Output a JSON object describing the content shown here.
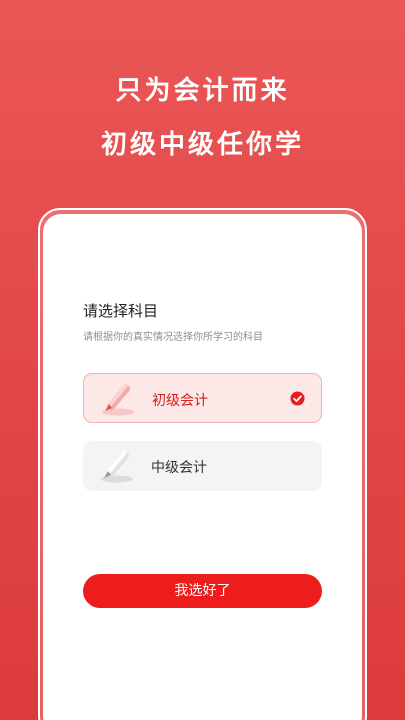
{
  "hero": {
    "line1": "只为会计而来",
    "line2": "初级中级任你学"
  },
  "selector": {
    "title": "请选择科目",
    "subtitle": "请根据你的真实情况选择你所学习的科目",
    "options": [
      {
        "label": "初级会计",
        "selected": true,
        "icon": "pencil-icon"
      },
      {
        "label": "中级会计",
        "selected": false,
        "icon": "pencil-icon"
      }
    ],
    "confirm_label": "我选好了"
  },
  "colors": {
    "accent": "#ee1d1d",
    "selected_bg": "#fde8e8",
    "background_top": "#ea5656"
  }
}
